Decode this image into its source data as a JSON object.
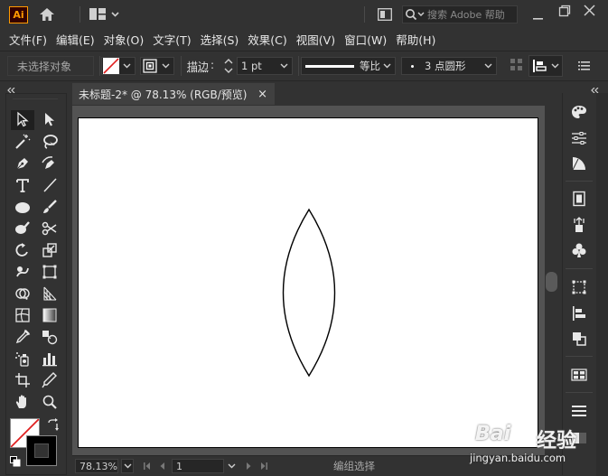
{
  "app": {
    "logo_text": "Ai"
  },
  "search": {
    "placeholder": "搜索 Adobe 帮助"
  },
  "menu": [
    "文件(F)",
    "编辑(E)",
    "对象(O)",
    "文字(T)",
    "选择(S)",
    "效果(C)",
    "视图(V)",
    "窗口(W)",
    "帮助(H)"
  ],
  "control": {
    "no_selection": "未选择对象",
    "stroke_label": "描边",
    "stroke_colon": ":",
    "stroke_weight": "1 pt",
    "profile_label": "等比",
    "brush_value": "3 点圆形"
  },
  "document": {
    "tab_title": "未标题-2* @ 78.13% (RGB/预览)",
    "close_glyph": "×"
  },
  "status": {
    "zoom": "78.13%",
    "page": "1",
    "mode": "编组选择"
  },
  "watermark": {
    "brand": "Bai",
    "brand2": "经验",
    "url": "jingyan.baidu.com"
  },
  "colors": {
    "accent": "#ff9a00",
    "ui_bg": "#323232",
    "canvas_bg": "#535353",
    "artboard": "#ffffff",
    "none_slash": "#e02020"
  },
  "icons": {
    "title_bar": [
      "home-icon",
      "workspace-layout-icon",
      "panel-icon",
      "search-icon",
      "minimize-icon",
      "restore-icon",
      "close-icon"
    ],
    "tools": [
      "selection-tool-icon",
      "direct-selection-tool-icon",
      "magic-wand-icon",
      "lasso-icon",
      "pen-tool-icon",
      "curvature-tool-icon",
      "type-tool-icon",
      "line-tool-icon",
      "ellipse-tool-icon",
      "paintbrush-icon",
      "shaper-tool-icon",
      "scissors-icon",
      "rotate-tool-icon",
      "scale-tool-icon",
      "warp-tool-icon",
      "free-transform-icon",
      "shape-builder-icon",
      "perspective-grid-icon",
      "mesh-tool-icon",
      "gradient-tool-icon",
      "eyedropper-icon",
      "blend-tool-icon",
      "symbol-sprayer-icon",
      "column-graph-icon",
      "artboard-tool-icon",
      "slice-tool-icon",
      "hand-tool-icon",
      "zoom-tool-icon"
    ],
    "right_panel": [
      "color-palette-icon",
      "properties-icon",
      "color-guide-icon",
      "document-icon",
      "asset-export-icon",
      "symbols-icon",
      "transform-icon",
      "align-icon",
      "pathfinder-icon",
      "swatches-icon",
      "layers-icon",
      "appearance-icon"
    ]
  }
}
